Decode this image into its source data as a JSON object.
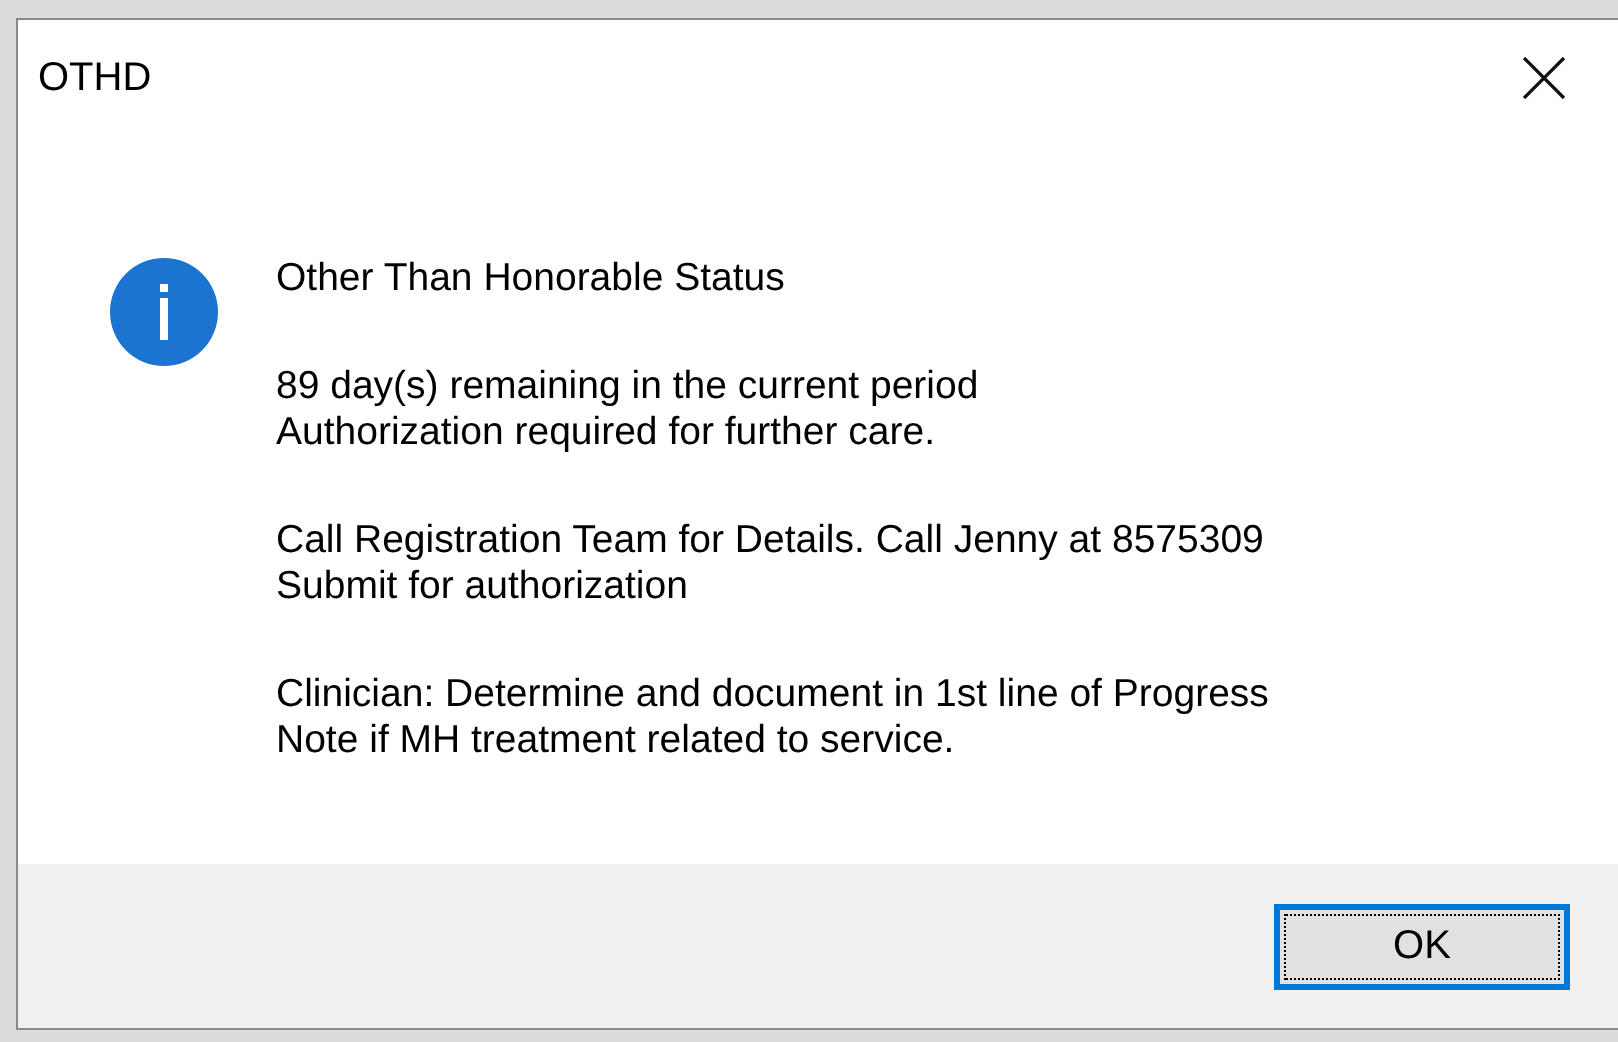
{
  "window": {
    "title": "OTHD"
  },
  "message": {
    "heading": "Other Than Honorable Status",
    "paragraphs": [
      [
        "89 day(s) remaining in the current period",
        "Authorization required for further care."
      ],
      [
        "Call Registration Team for Details. Call Jenny at 8575309",
        "Submit for authorization"
      ],
      [
        "Clinician: Determine and document in 1st line of Progress",
        "Note if MH treatment related to service."
      ]
    ]
  },
  "buttons": [
    {
      "label": "OK",
      "focused": true
    }
  ]
}
